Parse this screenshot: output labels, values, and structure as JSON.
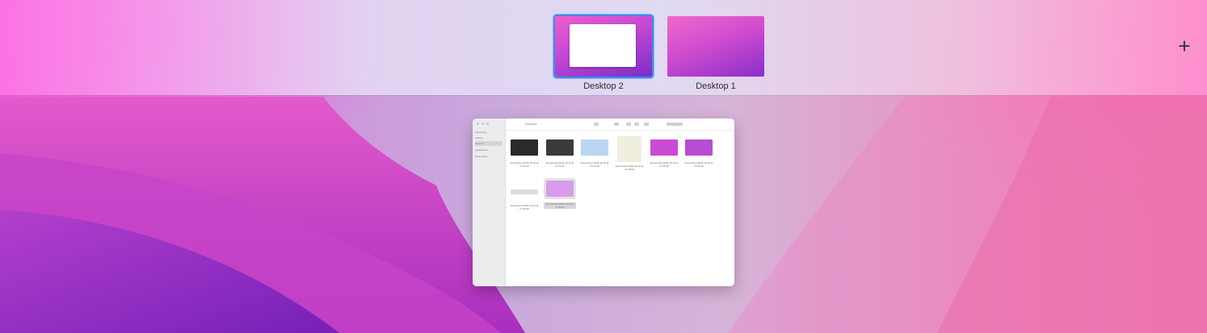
{
  "spaces": [
    {
      "label": "Desktop 2",
      "active": true
    },
    {
      "label": "Desktop 1",
      "active": false
    }
  ],
  "add_space_icon": "plus-icon",
  "finder": {
    "title": "Desktop",
    "sidebar_heading": "Favourites",
    "sidebar_items": [
      "Airdrop",
      "Recents",
      "Applications",
      "Documents"
    ],
    "files": [
      {
        "caption": "Screenshot 2022-12-19 at 17.24.16",
        "thumb_color": "#2a2a2a"
      },
      {
        "caption": "Screenshot 2022-12-19 at 17.24.21",
        "thumb_color": "#3a3a3a"
      },
      {
        "caption": "Screenshot 2022-12-19 at 17.24.40",
        "thumb_color": "#bcd6f2"
      },
      {
        "caption": "Screenshot 2022-12-19 at 17.25.03",
        "thumb_color": "#f0eede"
      },
      {
        "caption": "Screenshot 2022-12-19 at 17.25.18",
        "thumb_color": "#c94bd4"
      },
      {
        "caption": "Screenshot 2022-12-19 at 17.25.33",
        "thumb_color": "#b84cd2"
      },
      {
        "caption": "Screenshot 2022-12-19 at 17.26.05",
        "thumb_color": "#dcdcdc"
      },
      {
        "caption": "Screenshot 2022-12-19 at 17.26.21",
        "thumb_color": "#d89ce8"
      }
    ]
  }
}
